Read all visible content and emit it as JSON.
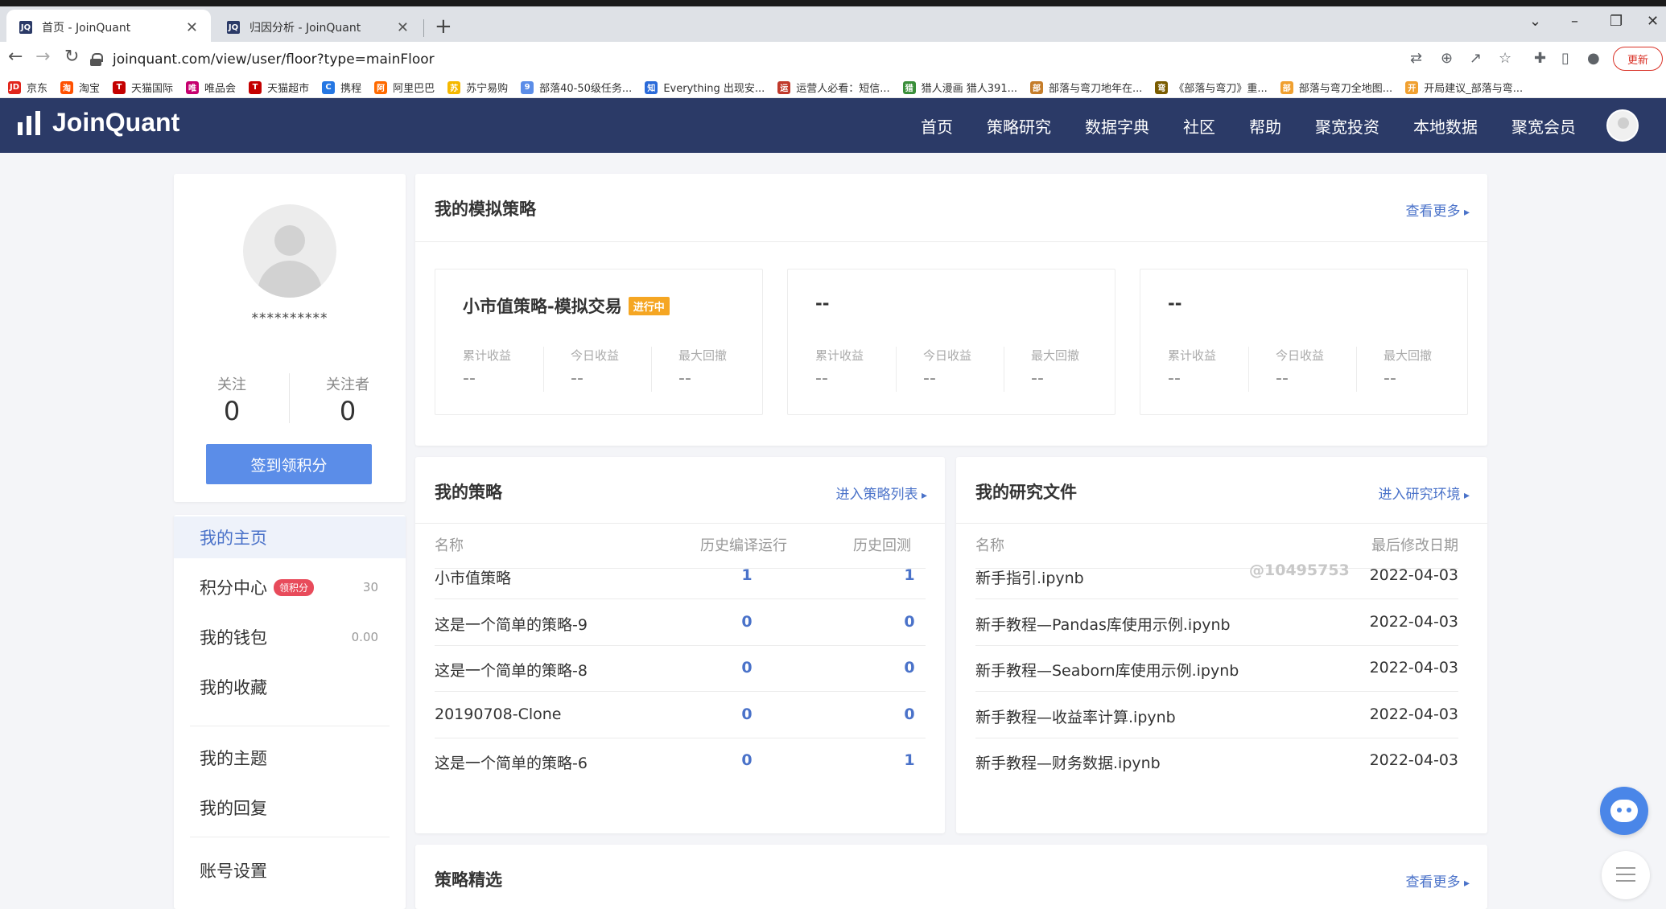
{
  "browser": {
    "tabs": [
      {
        "label": "首页 - JoinQuant",
        "favicon": "JQ"
      },
      {
        "label": "归因分析 - JoinQuant",
        "favicon": "JQ"
      }
    ],
    "url": "joinquant.com/view/user/floor?type=mainFloor",
    "update_label": "更新",
    "bookmarks": [
      {
        "label": "京东",
        "color": "#e1251b",
        "glyph": "JD"
      },
      {
        "label": "淘宝",
        "color": "#ff5000",
        "glyph": "淘"
      },
      {
        "label": "天猫国际",
        "color": "#c40000",
        "glyph": "T"
      },
      {
        "label": "唯品会",
        "color": "#c6006e",
        "glyph": "唯"
      },
      {
        "label": "天猫超市",
        "color": "#c40000",
        "glyph": "T"
      },
      {
        "label": "携程",
        "color": "#2577e3",
        "glyph": "C"
      },
      {
        "label": "阿里巴巴",
        "color": "#ff6a00",
        "glyph": "阿"
      },
      {
        "label": "苏宁易购",
        "color": "#f5b800",
        "glyph": "苏"
      },
      {
        "label": "部落40-50级任务...",
        "color": "#5b8de8",
        "glyph": "9"
      },
      {
        "label": "Everything 出现安...",
        "color": "#2a6ad9",
        "glyph": "知"
      },
      {
        "label": "运营人必看：短信...",
        "color": "#c0392b",
        "glyph": "运"
      },
      {
        "label": "猎人漫画 猎人391...",
        "color": "#3a8f3a",
        "glyph": "猎"
      },
      {
        "label": "部落与弯刀地年在...",
        "color": "#c57d2a",
        "glyph": "部"
      },
      {
        "label": "《部落与弯刀》重...",
        "color": "#7a5c00",
        "glyph": "弯"
      },
      {
        "label": "部落与弯刀全地图...",
        "color": "#f0a030",
        "glyph": "部"
      },
      {
        "label": "开局建议_部落与弯...",
        "color": "#f0a030",
        "glyph": "开"
      }
    ]
  },
  "site": {
    "logo": "JoinQuant",
    "nav": [
      "首页",
      "策略研究",
      "数据字典",
      "社区",
      "帮助",
      "聚宽投资",
      "本地数据",
      "聚宽会员"
    ]
  },
  "profile": {
    "username": "**********",
    "follow_label": "关注",
    "follow_count": "0",
    "follower_label": "关注者",
    "follower_count": "0",
    "signin_button": "签到领积分"
  },
  "menu": {
    "items": [
      {
        "label": "我的主页"
      },
      {
        "label": "积分中心",
        "badge": "领积分",
        "value": "30"
      },
      {
        "label": "我的钱包",
        "value": "0.00"
      },
      {
        "label": "我的收藏"
      },
      {
        "label": "我的主题"
      },
      {
        "label": "我的回复"
      },
      {
        "label": "账号设置"
      }
    ]
  },
  "sim": {
    "title": "我的模拟策略",
    "more": "查看更多",
    "boxes": [
      {
        "name": "小市值策略-模拟交易",
        "badge": "进行中",
        "metrics": [
          {
            "label": "累计收益",
            "value": "--"
          },
          {
            "label": "今日收益",
            "value": "--"
          },
          {
            "label": "最大回撤",
            "value": "--"
          }
        ]
      },
      {
        "name": "--",
        "badge": "",
        "metrics": [
          {
            "label": "累计收益",
            "value": "--"
          },
          {
            "label": "今日收益",
            "value": "--"
          },
          {
            "label": "最大回撤",
            "value": "--"
          }
        ]
      },
      {
        "name": "--",
        "badge": "",
        "metrics": [
          {
            "label": "累计收益",
            "value": "--"
          },
          {
            "label": "今日收益",
            "value": "--"
          },
          {
            "label": "最大回撤",
            "value": "--"
          }
        ]
      }
    ]
  },
  "strategies": {
    "title": "我的策略",
    "more": "进入策略列表",
    "columns": [
      "名称",
      "历史编译运行",
      "历史回测"
    ],
    "rows": [
      {
        "name": "小市值策略",
        "compile": "1",
        "backtest": "1"
      },
      {
        "name": "这是一个简单的策略-9",
        "compile": "0",
        "backtest": "0"
      },
      {
        "name": "这是一个简单的策略-8",
        "compile": "0",
        "backtest": "0"
      },
      {
        "name": "20190708-Clone",
        "compile": "0",
        "backtest": "0"
      },
      {
        "name": "这是一个简单的策略-6",
        "compile": "0",
        "backtest": "1"
      }
    ]
  },
  "research": {
    "title": "我的研究文件",
    "more": "进入研究环境",
    "columns": [
      "名称",
      "最后修改日期"
    ],
    "rows": [
      {
        "name": "新手指引.ipynb",
        "date": "2022-04-03"
      },
      {
        "name": "新手教程—Pandas库使用示例.ipynb",
        "date": "2022-04-03"
      },
      {
        "name": "新手教程—Seaborn库使用示例.ipynb",
        "date": "2022-04-03"
      },
      {
        "name": "新手教程—收益率计算.ipynb",
        "date": "2022-04-03"
      },
      {
        "name": "新手教程—财务数据.ipynb",
        "date": "2022-04-03"
      }
    ]
  },
  "featured": {
    "title": "策略精选",
    "more": "查看更多"
  },
  "watermark": "@10495753",
  "colors": {
    "header": "#2b3a67",
    "accent": "#4a72c9",
    "button": "#5b8de8",
    "badge_orange": "#f5a623",
    "badge_red": "#e84b5b"
  }
}
